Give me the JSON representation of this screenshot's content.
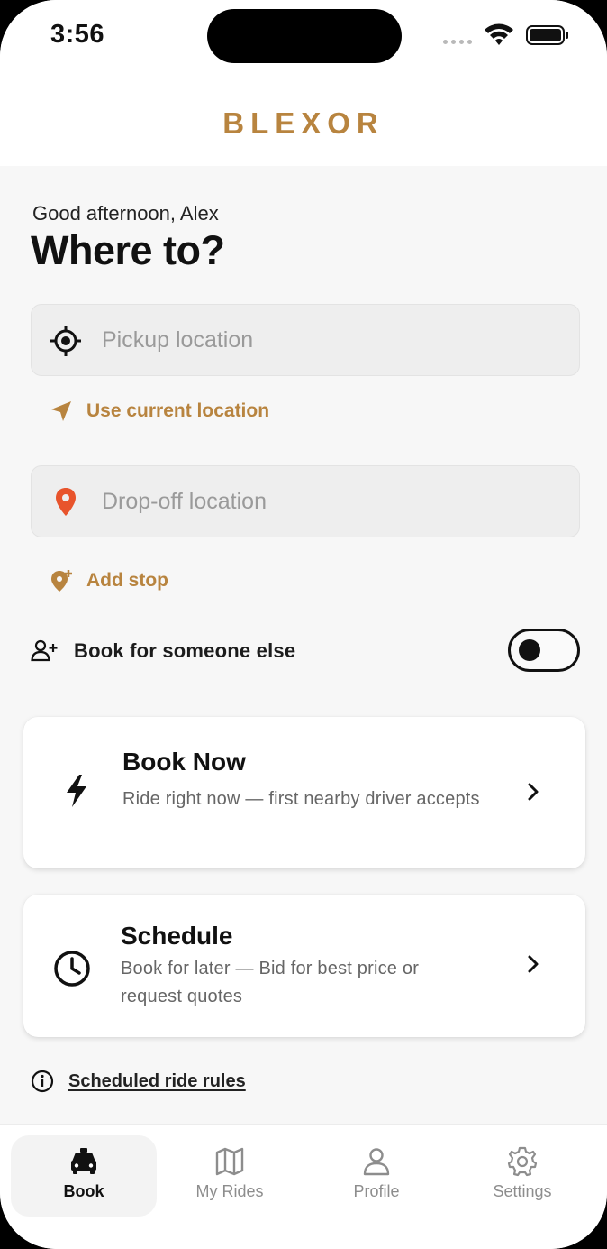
{
  "status": {
    "time": "3:56"
  },
  "header": {
    "brand": "BLEXOR"
  },
  "greeting": "Good afternoon, Alex",
  "title": "Where to?",
  "pickup": {
    "placeholder": "Pickup location"
  },
  "use_current_location": "Use current location",
  "dropoff": {
    "placeholder": "Drop-off location"
  },
  "add_stop": "Add stop",
  "book_for_someone": {
    "label": "Book for someone else",
    "enabled": false
  },
  "book_now": {
    "title": "Book Now",
    "subtitle": "Ride right now — first nearby driver accepts"
  },
  "schedule": {
    "title": "Schedule",
    "subtitle": "Book for later — Bid for best price or request quotes"
  },
  "rules_link": "Scheduled ride rules",
  "nav": {
    "items": [
      {
        "label": "Book",
        "icon": "car-icon",
        "active": true
      },
      {
        "label": "My Rides",
        "icon": "map-icon",
        "active": false
      },
      {
        "label": "Profile",
        "icon": "person-icon",
        "active": false
      },
      {
        "label": "Settings",
        "icon": "gear-icon",
        "active": false
      }
    ]
  },
  "colors": {
    "accent": "#b8843f",
    "pin": "#e8542c",
    "background": "#f7f7f7"
  }
}
